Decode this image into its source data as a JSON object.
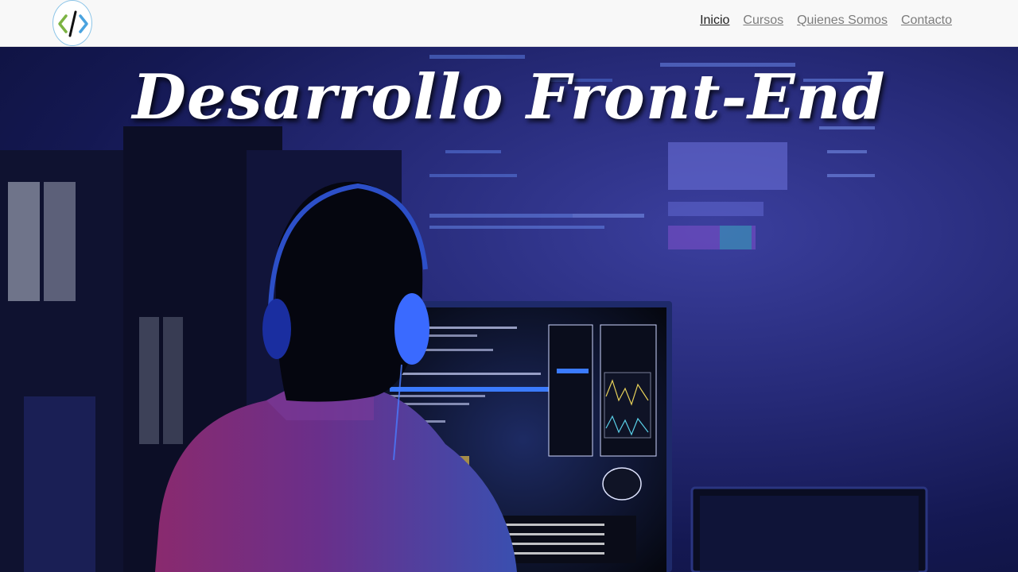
{
  "nav": {
    "items": [
      {
        "label": "Inicio",
        "active": true
      },
      {
        "label": "Cursos",
        "active": false
      },
      {
        "label": "Quienes Somos",
        "active": false
      },
      {
        "label": "Contacto",
        "active": false
      }
    ]
  },
  "hero": {
    "title": "Desarrollo Front-End"
  },
  "colors": {
    "logo_left_chevron": "#7cb342",
    "logo_right_chevron": "#4aa3df",
    "logo_slash": "#111111",
    "hero_bg": "#1a1f66"
  }
}
